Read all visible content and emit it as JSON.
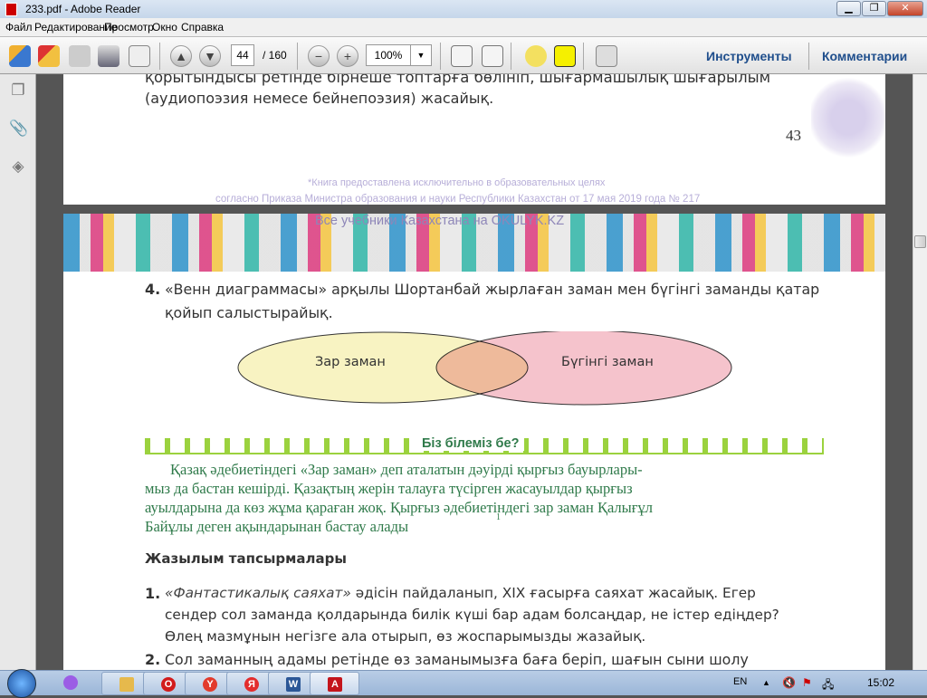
{
  "window": {
    "title": "233.pdf - Adobe Reader",
    "min": "▁",
    "max": "❐",
    "close": "✕"
  },
  "menu": [
    "Файл",
    "Редактирование",
    "Просмотр",
    "Окно",
    "Справка"
  ],
  "toolbar": {
    "page": "44",
    "total": "/ 160",
    "zoom": "100%",
    "tools": "Инструменты",
    "comments": "Комментарии"
  },
  "page1": {
    "line1": "қорытындысы ретінде бірнеше топтарға бөлініп, шығармашылық шығарылым",
    "line2": "(аудиопоэзия немесе бейнепоэзия) жасайық.",
    "page_number": "43",
    "wm1": "*Книга предоставлена исключительно в образовательных целях",
    "wm2": "согласно Приказа Министра образования и науки Республики Казахстан от 17 мая 2019 года № 217"
  },
  "page2": {
    "wm": "Все учебники Казахстана на OKULYK.KZ",
    "task4_num": "4.",
    "task4_l1": "«Венн диаграммасы» арқылы Шортанбай жырлаған заман мен бүгінгі заманды қатар",
    "task4_l2": "қойып салыстырайық.",
    "venn_left": "Зар заман",
    "venn_right": "Бүгінгі заман",
    "box_title": "Біз білеміз бе?",
    "box_lines": [
      "Қазақ  әдебиетіндегі  «Зар заман»  деп  аталатын  дәуірді  қырғыз  бауырлары-",
      "мыз  да  бастан  кешірді.  Қазақтың  жерін  талауға  түсірген  жасауылдар  қырғыз",
      "ауылдарына   да  көз  жұма  қараған  жоқ.  Қырғыз  әдебиетіндегі  зар заман  Қалығұл",
      "Байұлы  деген  ақындарынан   бастау  алады"
    ],
    "footnote": "1",
    "section": "Жазылым тапсырмалары",
    "t1_num": "1.",
    "t1_italic": "«Фантастикалық саяхат»",
    "t1_l1": " әдісін пайдаланып, XIX ғасырға саяхат жасайық. Егер",
    "t1_l2": "сендер сол заманда қолдарында билік күші бар адам болсаңдар, не істер едіңдер?",
    "t1_l3": "Өлең мазмұнын негізге ала отырып, өз жоспарымызды жазайық.",
    "t2_num": "2.",
    "t2_l1": "Сол заманның адамы ретінде өз заманымызға баға беріп, шағын сыни шолу"
  },
  "taskbar": {
    "lang": "EN",
    "clock": "15:02",
    "apps": [
      {
        "icon": "alice-icon",
        "glyph": "●",
        "color": "#9b5de5"
      },
      {
        "icon": "folder-icon",
        "glyph": "▤",
        "color": "#e6b94c"
      },
      {
        "icon": "opera-icon",
        "glyph": "O",
        "color": "#d21c1c"
      },
      {
        "icon": "yandex-browser-icon",
        "glyph": "Y",
        "color": "#e23b2c"
      },
      {
        "icon": "yandex-icon",
        "glyph": "Я",
        "color": "#e32d2d"
      },
      {
        "icon": "word-icon",
        "glyph": "W",
        "color": "#2b5797"
      },
      {
        "icon": "adobe-reader-icon",
        "glyph": "A",
        "color": "#c4151c"
      }
    ]
  }
}
